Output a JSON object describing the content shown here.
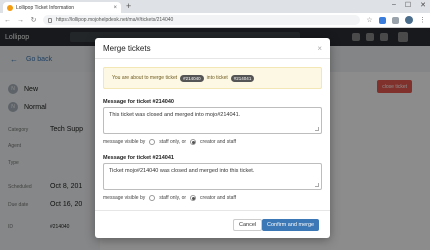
{
  "browser": {
    "tab_title": "Lollipop Ticket Information",
    "tab_close": "×",
    "new_tab": "+",
    "url": "https://lollipop.mojohelpdesk.net/ma/#/tickets/214040",
    "window_controls": [
      "–",
      "☐",
      "✕"
    ]
  },
  "app": {
    "brand": "Lollipop",
    "go_back": "Go back",
    "close_ticket": "close ticket",
    "fields": [
      {
        "icon": "N",
        "label": "",
        "value": "New"
      },
      {
        "icon": "N",
        "label": "",
        "value": "Normal"
      },
      {
        "icon": "",
        "label": "Category",
        "value": "Tech Supp"
      },
      {
        "icon": "",
        "label": "Agent",
        "value": ""
      },
      {
        "icon": "",
        "label": "Type",
        "value": ""
      },
      {
        "icon": "",
        "label": "Scheduled",
        "value": "Oct 8, 201"
      },
      {
        "icon": "",
        "label": "Due date",
        "value": "Oct 16, 20"
      },
      {
        "icon": "",
        "label": "ID",
        "value": "#214040"
      }
    ]
  },
  "modal": {
    "title": "Merge tickets",
    "close_glyph": "×",
    "notice_prefix": "You are about to merge ticket",
    "notice_middle": "into ticket",
    "source_ticket": "#214040",
    "target_ticket": "#214041",
    "section1_label": "Message for ticket #214040",
    "section1_message": "This ticket was closed and merged into mojo#214041.",
    "section2_label": "Message for ticket #214041",
    "section2_message": "Ticket mojo#214040 was closed and merged into this ticket.",
    "visible_by_label": "message visible by",
    "option_staff": "staff only, or",
    "option_creator": "creator and staff",
    "cancel_label": "Cancel",
    "confirm_label": "Confirm and merge"
  }
}
